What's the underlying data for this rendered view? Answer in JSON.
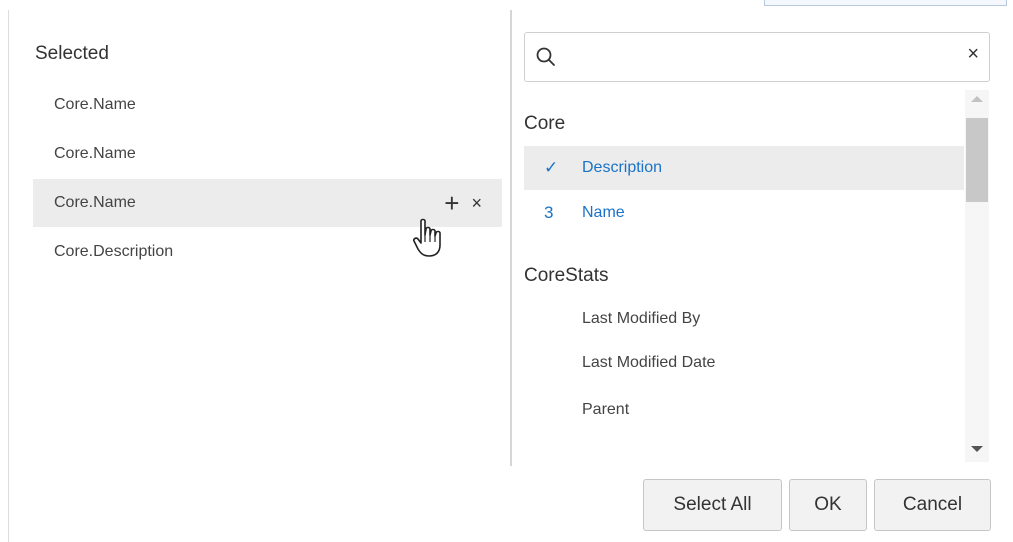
{
  "left_panel": {
    "title": "Selected",
    "items": [
      {
        "label": "Core.Name"
      },
      {
        "label": "Core.Name"
      },
      {
        "label": "Core.Name"
      },
      {
        "label": "Core.Description"
      }
    ],
    "hover_actions": {
      "add": "+",
      "remove": "×"
    }
  },
  "search": {
    "value": "",
    "placeholder": "",
    "clear": "×"
  },
  "groups": [
    {
      "title": "Core",
      "fields": [
        {
          "marker": "✓",
          "label": "Description",
          "state": "selected"
        },
        {
          "marker": "3",
          "label": "Name",
          "state": "selected-count"
        }
      ]
    },
    {
      "title": "CoreStats",
      "fields": [
        {
          "marker": "",
          "label": "Last Modified By"
        },
        {
          "marker": "",
          "label": "Last Modified Date"
        },
        {
          "marker": "",
          "label": "Parent"
        }
      ]
    }
  ],
  "footer": {
    "select_all": "Select All",
    "ok": "OK",
    "cancel": "Cancel"
  },
  "colors": {
    "accent": "#1a73c7",
    "hover_bg": "#ececec",
    "button_bg": "#f2f2f2"
  },
  "icons": {
    "search": "search-icon",
    "cursor": "hand-pointer-icon",
    "check": "checkmark-icon"
  }
}
